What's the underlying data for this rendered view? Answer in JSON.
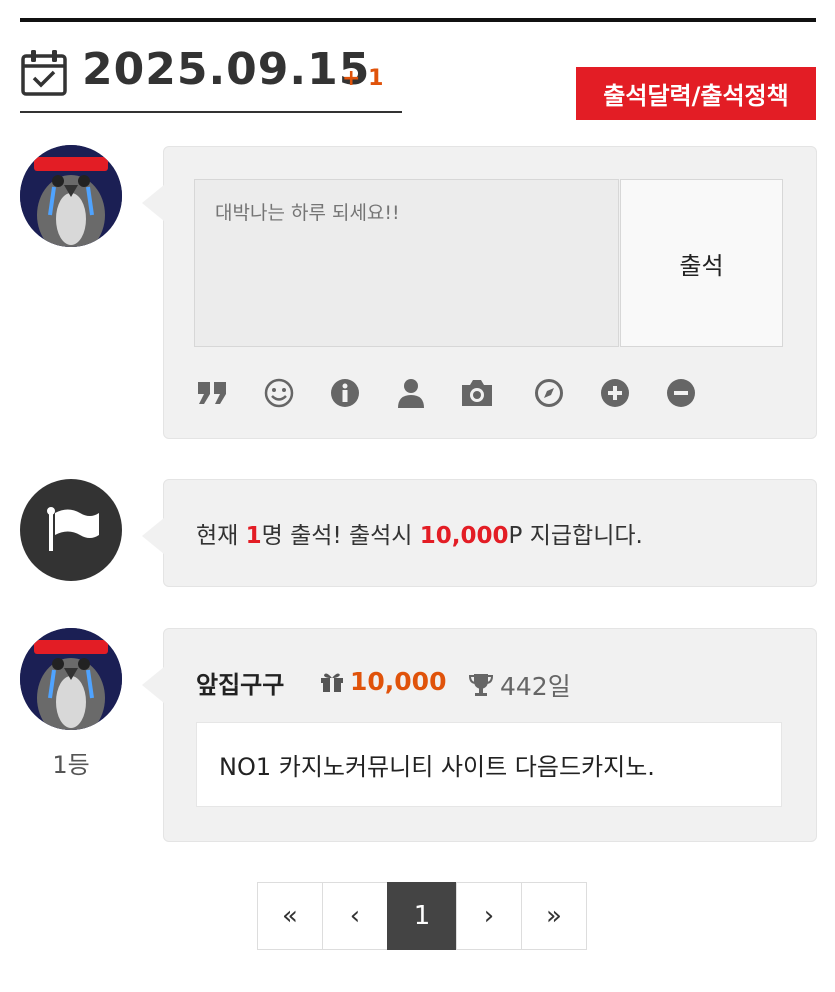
{
  "header": {
    "date": "2025.09.15",
    "plus": "+ 1",
    "policy_button": "출석달력/출석정책"
  },
  "composer": {
    "placeholder": "대박나는 하루 되세요!!",
    "submit_label": "출석",
    "tools": [
      "quote-icon",
      "smile-icon",
      "info-icon",
      "user-icon",
      "camera-icon",
      "compass-icon",
      "plus-circle-icon",
      "minus-circle-icon"
    ]
  },
  "notice": {
    "prefix": "현재 ",
    "count": "1",
    "mid": "명 출석! 출석시 ",
    "points": "10,000",
    "suffix": "P 지급합니다."
  },
  "entry": {
    "username": "앞집구구",
    "gift_points": "10,000",
    "days": "442일",
    "comment": "NO1 카지노커뮤니티 사이트 다음드카지노.",
    "rank": "1등"
  },
  "pagination": {
    "first": "«",
    "prev": "‹",
    "current": "1",
    "next": "›",
    "last": "»"
  },
  "colors": {
    "accent_red": "#e31d25",
    "accent_orange": "#e0530b",
    "panel_bg": "#f1f1f1"
  }
}
